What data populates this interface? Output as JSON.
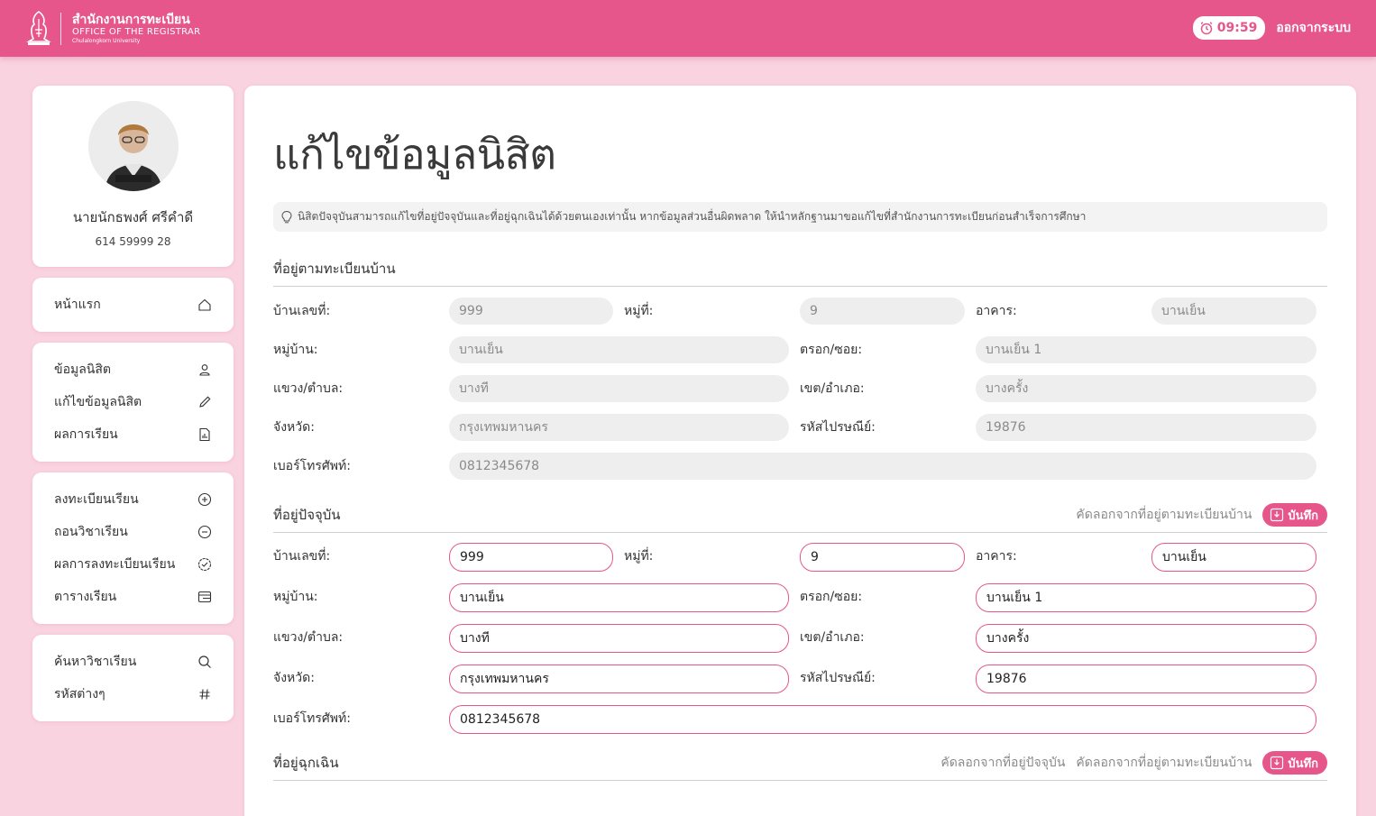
{
  "header": {
    "org_th": "สำนักงานการทะเบียน",
    "org_en": "OFFICE OF THE REGISTRAR",
    "university": "Chulalongkorn University",
    "timer": "09:59",
    "logout": "ออกจากระบบ"
  },
  "profile": {
    "name": "นายนักธพงศ์ ศรีคำดี",
    "student_id": "614 59999 28"
  },
  "menu": {
    "home": "หน้าแรก",
    "student_info": "ข้อมูลนิสิต",
    "edit_info": "แก้ไขข้อมูลนิสิต",
    "grades": "ผลการเรียน",
    "register": "ลงทะเบียนเรียน",
    "withdraw": "ถอนวิชาเรียน",
    "reg_result": "ผลการลงทะเบียนเรียน",
    "timetable": "ตารางเรียน",
    "search_course": "ค้นหาวิชาเรียน",
    "codes": "รหัสต่างๆ"
  },
  "page": {
    "title": "แก้ไขข้อมูลนิสิต",
    "notice": "นิสิตปัจจุบันสามารถแก้ไขที่อยู่ปัจจุบันและที่อยู่ฉุกเฉินได้ด้วยตนเองเท่านั้น หากข้อมูลส่วนอื่นผิดพลาด ให้นำหลักฐานมาขอแก้ไขที่สำนักงานการทะเบียนก่อนสำเร็จการศึกษา"
  },
  "labels": {
    "house_no": "บ้านเลขที่:",
    "moo": "หมู่ที่:",
    "building": "อาคาร:",
    "village": "หมู่บ้าน:",
    "soi": "ตรอก/ซอย:",
    "subdistrict": "แขวง/ตำบล:",
    "district": "เขต/อำเภอ:",
    "province": "จังหวัด:",
    "postcode": "รหัสไปรษณีย์:",
    "phone": "เบอร์โทรศัพท์:"
  },
  "registered": {
    "title": "ที่อยู่ตามทะเบียนบ้าน",
    "house_no": "999",
    "moo": "9",
    "building": "บานเย็น",
    "village": "บานเย็น",
    "soi": "บานเย็น 1",
    "subdistrict": "บางที",
    "district": "บางครั้ง",
    "province": "กรุงเทพมหานคร",
    "postcode": "19876",
    "phone": "0812345678"
  },
  "current": {
    "title": "ที่อยู่ปัจจุบัน",
    "copy_registered": "คัดลอกจากที่อยู่ตามทะเบียนบ้าน",
    "save": "บันทึก",
    "house_no": "999",
    "moo": "9",
    "building": "บานเย็น",
    "village": "บานเย็น",
    "soi": "บานเย็น 1",
    "subdistrict": "บางที",
    "district": "บางครั้ง",
    "province": "กรุงเทพมหานคร",
    "postcode": "19876",
    "phone": "0812345678"
  },
  "emergency": {
    "title": "ที่อยู่ฉุกเฉิน",
    "copy_current": "คัดลอกจากที่อยู่ปัจจุบัน",
    "copy_registered": "คัดลอกจากที่อยู่ตามทะเบียนบ้าน",
    "save": "บันทึก"
  },
  "colors": {
    "brand": "#e6568b",
    "background": "#f9d3df"
  }
}
